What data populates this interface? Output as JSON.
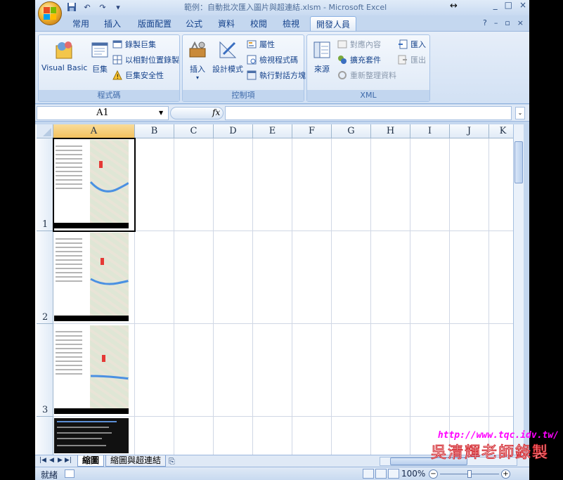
{
  "window": {
    "title": "範例：自動批次匯入圖片與超連結.xlsm - Microsoft Excel",
    "controls": [
      "_",
      "□",
      "×"
    ]
  },
  "quick_access": [
    "save-icon",
    "undo-icon",
    "redo-icon",
    "customize-icon"
  ],
  "ribbon_tabs": [
    {
      "label": "常用"
    },
    {
      "label": "插入"
    },
    {
      "label": "版面配置"
    },
    {
      "label": "公式"
    },
    {
      "label": "資料"
    },
    {
      "label": "校閱"
    },
    {
      "label": "檢視"
    },
    {
      "label": "開發人員",
      "active": true
    }
  ],
  "ribbon": {
    "code_group": {
      "title": "程式碼",
      "visual_basic": "Visual Basic",
      "macros": "巨集",
      "record_macro": "錄製巨集",
      "relative_ref": "以相對位置錄製",
      "macro_security": "巨集安全性"
    },
    "controls_group": {
      "title": "控制項",
      "insert": "插入",
      "design_mode": "設計模式",
      "properties": "屬性",
      "view_code": "檢視程式碼",
      "run_dialog": "執行對話方塊"
    },
    "xml_group": {
      "title": "XML",
      "source": "來源",
      "map_properties": "對應內容",
      "expansion_packs": "擴充套件",
      "refresh_data": "重新整理資料",
      "import": "匯入",
      "export": "匯出"
    }
  },
  "formula_bar": {
    "name_box": "A1",
    "fx": "fx",
    "formula": ""
  },
  "grid": {
    "columns": [
      "A",
      "B",
      "C",
      "D",
      "E",
      "F",
      "G",
      "H",
      "I",
      "J",
      "K"
    ],
    "rows": [
      "1",
      "2",
      "3",
      ""
    ]
  },
  "sheet_tabs": [
    "縮圖",
    "縮圖與超連結"
  ],
  "status_bar": {
    "ready": "就緒",
    "zoom": "100%",
    "zoom_level_percent": 100
  },
  "watermark": {
    "url": "http://www.tqc.idv.tw/",
    "author": "吳清輝老師錄製"
  },
  "colors": {
    "accent": "#15428b",
    "selection_header": "#f2c15e",
    "ribbon_bg": "#dce8f6",
    "watermark_url": "#ff00ff",
    "watermark_name": "#d6282f"
  }
}
